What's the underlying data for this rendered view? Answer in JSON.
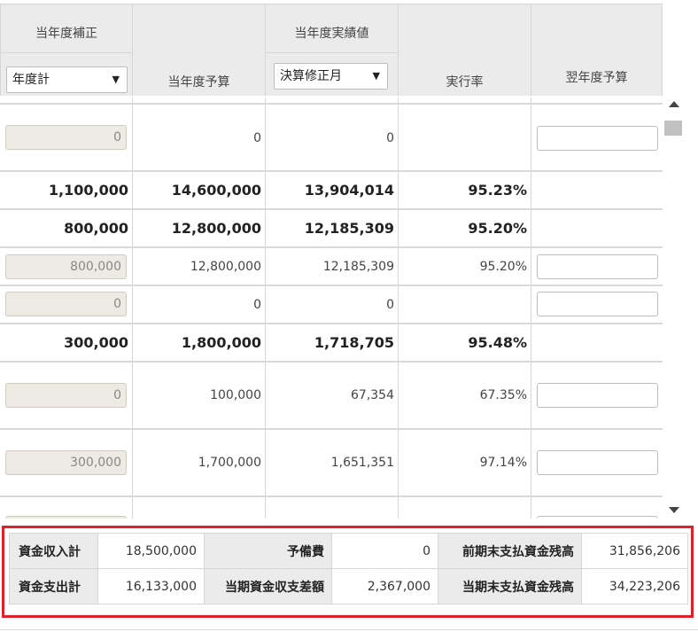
{
  "header": {
    "col1_title": "当年度補正",
    "col1_select": "年度計",
    "col2_label": "当年度予算",
    "col3_title": "当年度実績値",
    "col3_select": "決算修正月",
    "col4_label": "実行率",
    "col5_label": "翌年度予算",
    "select_arrow": "▼"
  },
  "rows": [
    {
      "kind": "input",
      "hosei": "0",
      "yosan": "0",
      "jisseki": "0",
      "rate": ""
    },
    {
      "kind": "total",
      "hosei": "1,100,000",
      "yosan": "14,600,000",
      "jisseki": "13,904,014",
      "rate": "95.23%"
    },
    {
      "kind": "total",
      "hosei": "800,000",
      "yosan": "12,800,000",
      "jisseki": "12,185,309",
      "rate": "95.20%"
    },
    {
      "kind": "input",
      "hosei": "800,000",
      "yosan": "12,800,000",
      "jisseki": "12,185,309",
      "rate": "95.20%"
    },
    {
      "kind": "input",
      "hosei": "0",
      "yosan": "0",
      "jisseki": "0",
      "rate": ""
    },
    {
      "kind": "total",
      "hosei": "300,000",
      "yosan": "1,800,000",
      "jisseki": "1,718,705",
      "rate": "95.48%"
    },
    {
      "kind": "input",
      "hosei": "0",
      "yosan": "100,000",
      "jisseki": "67,354",
      "rate": "67.35%"
    },
    {
      "kind": "input",
      "hosei": "300,000",
      "yosan": "1,700,000",
      "jisseki": "1,651,351",
      "rate": "97.14%"
    },
    {
      "kind": "input-partial",
      "hosei": "",
      "yosan": "",
      "jisseki": "",
      "rate": ""
    }
  ],
  "summary": {
    "r1": {
      "l1": "資金収入計",
      "v1": "18,500,000",
      "l2": "予備費",
      "v2": "0",
      "l3": "前期末支払資金残高",
      "v3": "31,856,206"
    },
    "r2": {
      "l1": "資金支出計",
      "v1": "16,133,000",
      "l2": "当期資金収支差額",
      "v2": "2,367,000",
      "l3": "当期末支払資金残高",
      "v3": "34,223,206"
    }
  },
  "colors": {
    "highlight_border": "#e0202a",
    "header_bg": "#ebebeb",
    "readonly_input_bg": "#eceae2"
  }
}
